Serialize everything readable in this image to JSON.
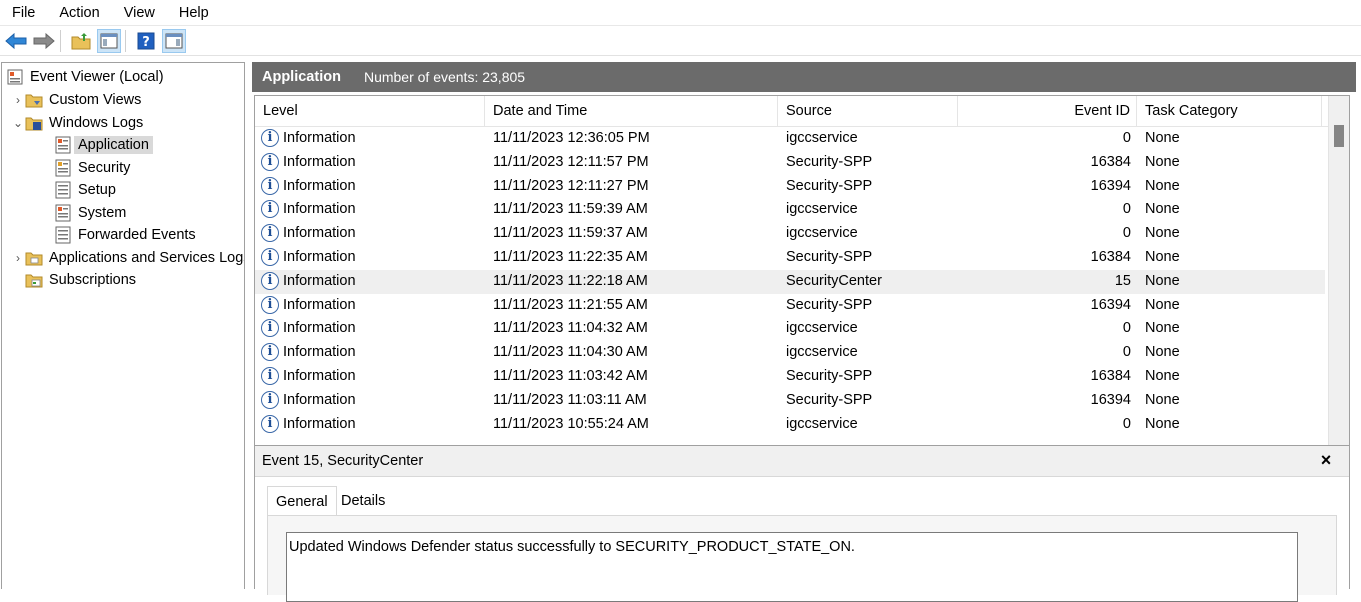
{
  "menu": [
    "File",
    "Action",
    "View",
    "Help"
  ],
  "tree": {
    "root": "Event Viewer (Local)",
    "custom_views": "Custom Views",
    "windows_logs": "Windows Logs",
    "application": "Application",
    "security": "Security",
    "setup": "Setup",
    "system": "System",
    "forwarded": "Forwarded Events",
    "app_services": "Applications and Services Logs",
    "subscriptions": "Subscriptions"
  },
  "header": {
    "log_name": "Application",
    "count_text": "Number of events: 23,805"
  },
  "columns": {
    "level": "Level",
    "date": "Date and Time",
    "source": "Source",
    "event_id": "Event ID",
    "task": "Task Category"
  },
  "rows": [
    {
      "level": "Information",
      "date": "11/11/2023 12:36:05 PM",
      "source": "igccservice",
      "id": "0",
      "task": "None"
    },
    {
      "level": "Information",
      "date": "11/11/2023 12:11:57 PM",
      "source": "Security-SPP",
      "id": "16384",
      "task": "None"
    },
    {
      "level": "Information",
      "date": "11/11/2023 12:11:27 PM",
      "source": "Security-SPP",
      "id": "16394",
      "task": "None"
    },
    {
      "level": "Information",
      "date": "11/11/2023 11:59:39 AM",
      "source": "igccservice",
      "id": "0",
      "task": "None"
    },
    {
      "level": "Information",
      "date": "11/11/2023 11:59:37 AM",
      "source": "igccservice",
      "id": "0",
      "task": "None"
    },
    {
      "level": "Information",
      "date": "11/11/2023 11:22:35 AM",
      "source": "Security-SPP",
      "id": "16384",
      "task": "None"
    },
    {
      "level": "Information",
      "date": "11/11/2023 11:22:18 AM",
      "source": "SecurityCenter",
      "id": "15",
      "task": "None"
    },
    {
      "level": "Information",
      "date": "11/11/2023 11:21:55 AM",
      "source": "Security-SPP",
      "id": "16394",
      "task": "None"
    },
    {
      "level": "Information",
      "date": "11/11/2023 11:04:32 AM",
      "source": "igccservice",
      "id": "0",
      "task": "None"
    },
    {
      "level": "Information",
      "date": "11/11/2023 11:04:30 AM",
      "source": "igccservice",
      "id": "0",
      "task": "None"
    },
    {
      "level": "Information",
      "date": "11/11/2023 11:03:42 AM",
      "source": "Security-SPP",
      "id": "16384",
      "task": "None"
    },
    {
      "level": "Information",
      "date": "11/11/2023 11:03:11 AM",
      "source": "Security-SPP",
      "id": "16394",
      "task": "None"
    },
    {
      "level": "Information",
      "date": "11/11/2023 10:55:24 AM",
      "source": "igccservice",
      "id": "0",
      "task": "None"
    }
  ],
  "detail": {
    "title": "Event 15, SecurityCenter",
    "close": "×",
    "tab_general": "General",
    "tab_details": "Details",
    "message": "Updated Windows Defender status successfully to SECURITY_PRODUCT_STATE_ON."
  },
  "info_glyph": "i"
}
